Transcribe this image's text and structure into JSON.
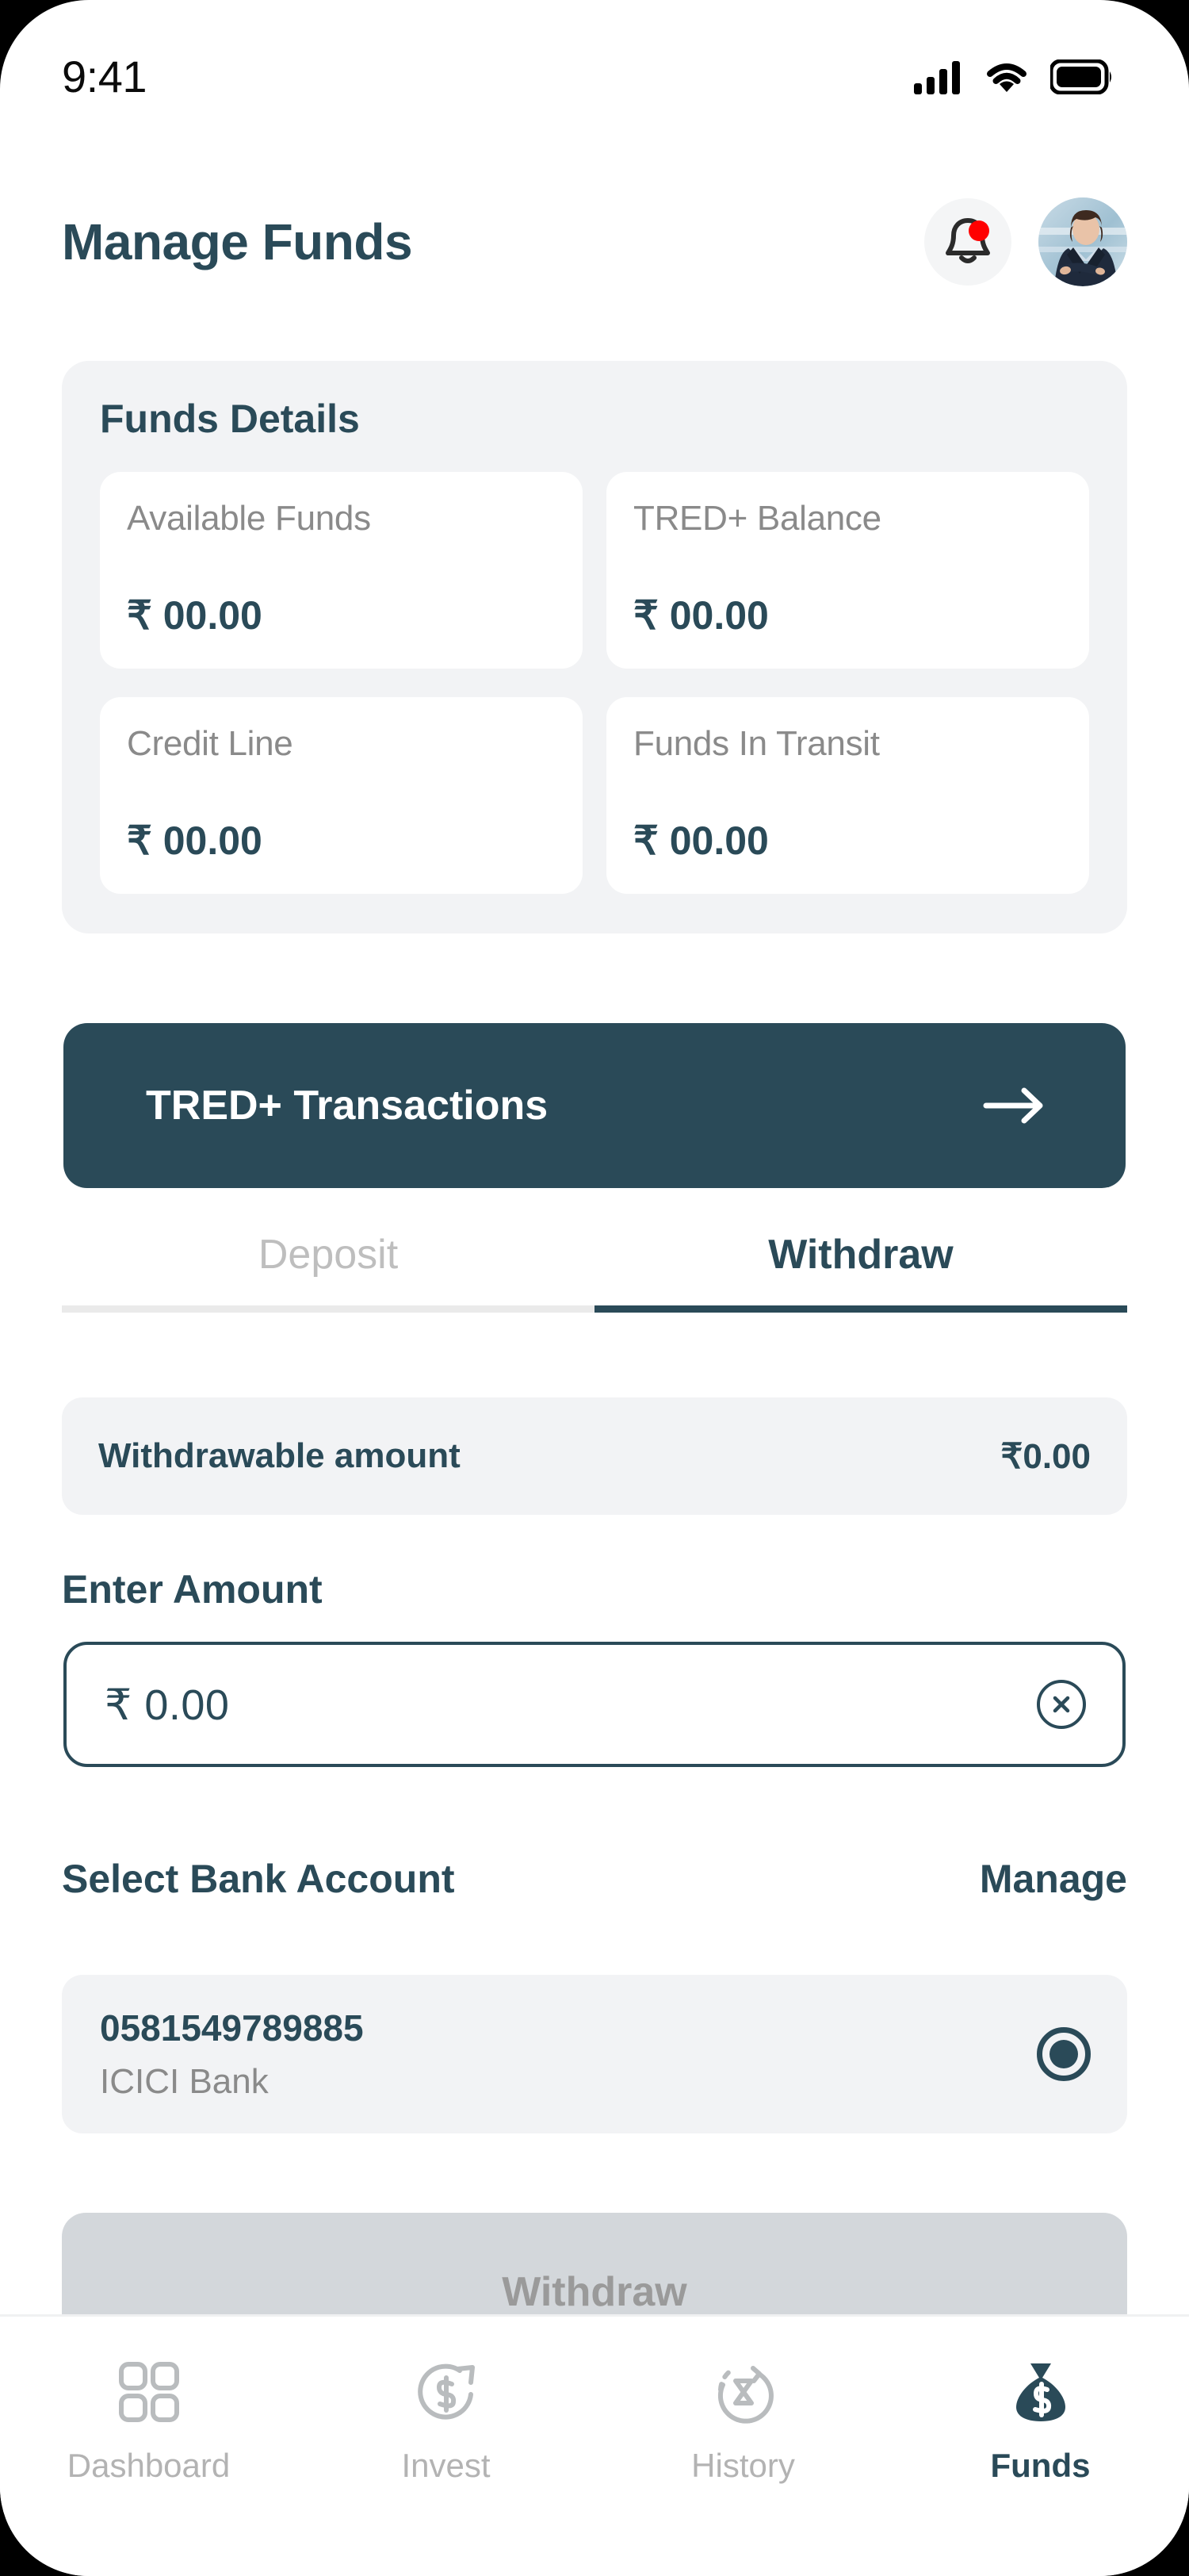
{
  "status_bar": {
    "time": "9:41",
    "icons": [
      "cellular-signal-icon",
      "wifi-icon",
      "battery-icon"
    ]
  },
  "header": {
    "title": "Manage Funds",
    "notification_icon": "bell-icon",
    "has_notification_dot": true,
    "avatar_icon": "user-avatar"
  },
  "funds_details": {
    "title": "Funds Details",
    "tiles": [
      {
        "label": "Available Funds",
        "value": "₹ 00.00"
      },
      {
        "label": "TRED+ Balance",
        "value": "₹ 00.00"
      },
      {
        "label": "Credit Line",
        "value": "₹ 00.00"
      },
      {
        "label": "Funds In Transit",
        "value": "₹ 00.00"
      }
    ]
  },
  "tred_transactions": {
    "label": "TRED+ Transactions",
    "arrow_icon": "arrow-right-icon"
  },
  "tabs": {
    "items": [
      {
        "label": "Deposit",
        "active": false
      },
      {
        "label": "Withdraw",
        "active": true
      }
    ]
  },
  "withdrawable": {
    "label": "Withdrawable amount",
    "value": "₹0.00"
  },
  "enter_amount": {
    "label": "Enter Amount",
    "value": "₹ 0.00",
    "placeholder": "₹ 0.00",
    "clear_icon": "close-circle-icon"
  },
  "bank_section": {
    "title": "Select Bank Account",
    "manage_label": "Manage",
    "accounts": [
      {
        "account_number": "0581549789885",
        "bank_name": "ICICI Bank",
        "selected": true
      }
    ]
  },
  "withdraw_submit": {
    "label": "Withdraw",
    "disabled": true
  },
  "bottom_nav": {
    "items": [
      {
        "label": "Dashboard",
        "icon": "grid-icon",
        "active": false
      },
      {
        "label": "Invest",
        "icon": "invest-icon",
        "active": false
      },
      {
        "label": "History",
        "icon": "history-icon",
        "active": false
      },
      {
        "label": "Funds",
        "icon": "money-bag-icon",
        "active": true
      }
    ]
  },
  "colors": {
    "brand_dark_teal": "#2A4A58",
    "surface_gray": "#F2F3F5",
    "muted_text": "#8A8A8A",
    "inactive_nav": "#B3B3B3",
    "notification_dot": "#FF0000",
    "disabled_button": "#D3D7DB"
  }
}
